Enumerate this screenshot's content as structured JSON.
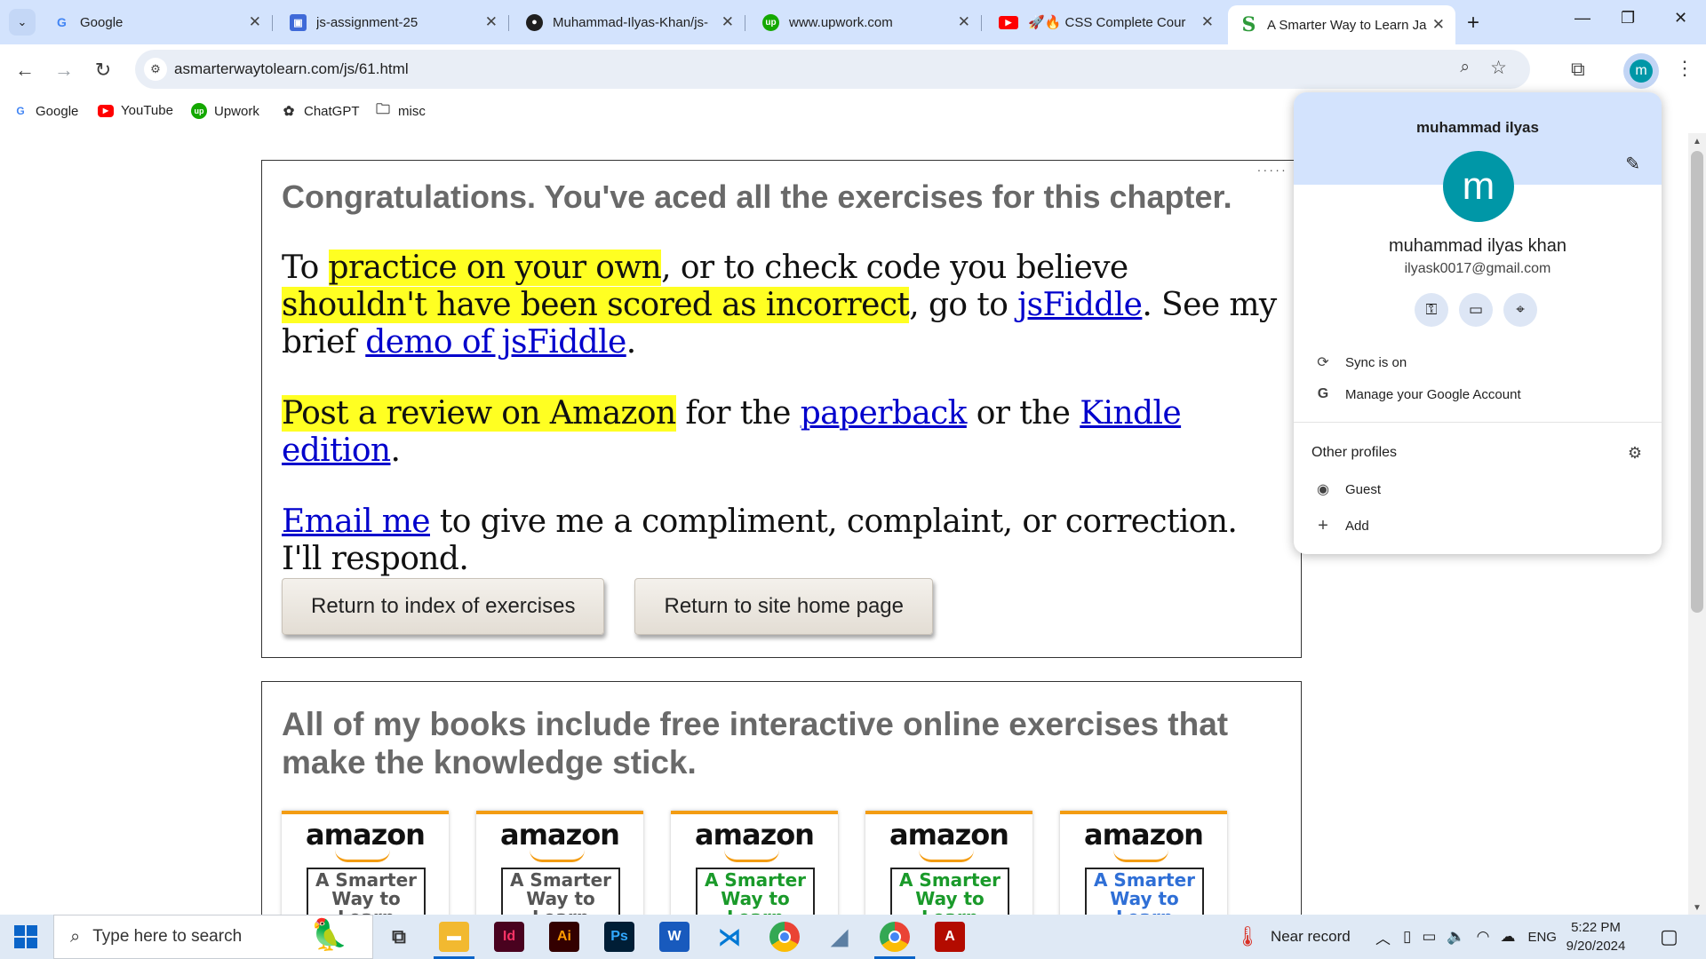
{
  "browser": {
    "tabs": [
      {
        "title": "Google",
        "favicon": "google-icon",
        "close": "✕"
      },
      {
        "title": "js-assignment-25",
        "favicon": "contact-card-icon",
        "close": "✕"
      },
      {
        "title": "Muhammad-Ilyas-Khan/js-",
        "favicon": "github-icon",
        "close": "✕"
      },
      {
        "title": "www.upwork.com",
        "favicon": "upwork-icon",
        "close": "✕"
      },
      {
        "title": "🚀🔥 CSS Complete Cour",
        "favicon": "youtube-icon",
        "close": "✕"
      },
      {
        "title": "A Smarter Way to Learn Ja",
        "favicon": "smarter-way-icon",
        "close": "✕",
        "active": true
      }
    ],
    "new_tab": "+",
    "url": "asmarterwaytolearn.com/js/61.html",
    "bookmarks": [
      {
        "label": "Google",
        "icon": "google-icon"
      },
      {
        "label": "YouTube",
        "icon": "youtube-icon"
      },
      {
        "label": "Upwork",
        "icon": "upwork-icon"
      },
      {
        "label": "ChatGPT",
        "icon": "chatgpt-icon"
      },
      {
        "label": "misc",
        "icon": "folder-icon"
      }
    ],
    "profile_initial": "m"
  },
  "page": {
    "heading": "Congratulations. You've aced all the exercises for this chapter.",
    "p1": {
      "t1": "To ",
      "h1": "practice on your own",
      "t2": ", or to check code you believe ",
      "h2": "shouldn't have been scored as incorrect",
      "t3": ", go to ",
      "l1": "jsFiddle",
      "t4": ". See my brief ",
      "l2": "demo of jsFiddle",
      "t5": "."
    },
    "p2": {
      "h1": "Post a review on Amazon",
      "t1": " for the ",
      "l1": "paperback",
      "t2": " or the ",
      "l2": "Kindle edition",
      "t3": "."
    },
    "p3": {
      "l1": "Email me",
      "t1": " to give me a compliment, complaint, or correction. I'll respond."
    },
    "buttons": {
      "index": "Return to index of exercises",
      "home": "Return to site home page"
    },
    "dots": ".....",
    "books_heading": "All of my books include free interactive online exercises that make the knowledge stick.",
    "books": [
      {
        "brand": "amazon",
        "cover": "A Smarter Way to Learn",
        "color": "#555555"
      },
      {
        "brand": "amazon",
        "cover": "A Smarter Way to Learn",
        "color": "#555555"
      },
      {
        "brand": "amazon",
        "cover": "A Smarter Way to Learn",
        "color": "#1a9a2a"
      },
      {
        "brand": "amazon",
        "cover": "A Smarter Way to Learn",
        "color": "#1a9a2a"
      },
      {
        "brand": "amazon",
        "cover": "A Smarter Way to Learn",
        "color": "#2f6fd6"
      }
    ]
  },
  "profile_menu": {
    "header_name": "muhammad ilyas",
    "avatar_initial": "m",
    "full_name": "muhammad ilyas khan",
    "email": "ilyask0017@gmail.com",
    "sync": "Sync is on",
    "manage": "Manage your Google Account",
    "other_profiles": "Other profiles",
    "guest": "Guest",
    "add": "Add"
  },
  "taskbar": {
    "search_placeholder": "Type here to search",
    "weather": "Near record",
    "language": "ENG",
    "time": "5:22 PM",
    "date": "9/20/2024"
  },
  "colors": {
    "accent": "#0097a7",
    "tabstrip": "#d3e3fd",
    "highlight": "#ffff22",
    "link": "#0000cc"
  }
}
